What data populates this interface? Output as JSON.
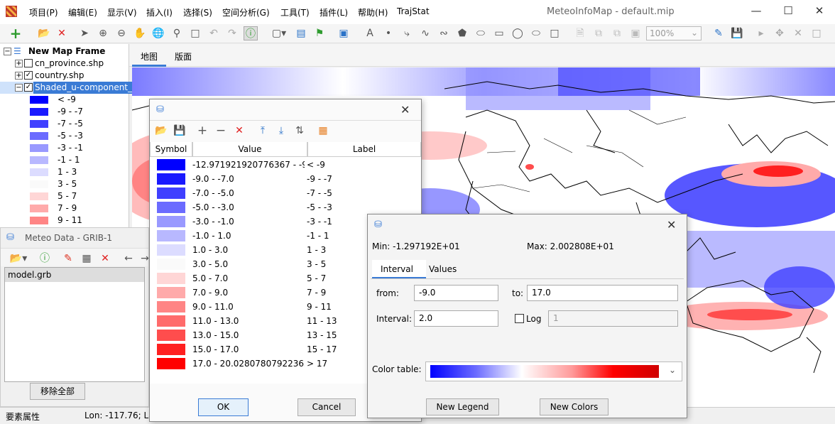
{
  "app": {
    "title": "MeteoInfoMap - default.mip",
    "menu": [
      "项目(P)",
      "编辑(E)",
      "显示(V)",
      "插入(I)",
      "选择(S)",
      "空间分析(G)",
      "工具(T)",
      "插件(L)",
      "帮助(H)",
      "TrajStat"
    ]
  },
  "toolbar": {
    "zoom": "100%"
  },
  "tree": {
    "frame": "New Map Frame",
    "layers": [
      {
        "name": "cn_province.shp",
        "checked": false
      },
      {
        "name": "country.shp",
        "checked": true
      },
      {
        "name": "Shaded_u-component_",
        "checked": true
      }
    ],
    "legend": [
      {
        "label": "< -9",
        "color": "#0000ff"
      },
      {
        "label": "-9 - -7",
        "color": "#1a1aff"
      },
      {
        "label": "-7 - -5",
        "color": "#4040ff"
      },
      {
        "label": "-5 - -3",
        "color": "#6b6bff"
      },
      {
        "label": "-3 - -1",
        "color": "#9999ff"
      },
      {
        "label": "-1 - 1",
        "color": "#b8b8ff"
      },
      {
        "label": "1 - 3",
        "color": "#dcdcff"
      },
      {
        "label": "3 - 5",
        "color": "#fafafa"
      },
      {
        "label": "5 - 7",
        "color": "#ffd6d6"
      },
      {
        "label": "7 - 9",
        "color": "#ffaaaa"
      },
      {
        "label": "9 - 11",
        "color": "#ff8585"
      }
    ]
  },
  "map_tabs": [
    "地图",
    "版面"
  ],
  "meteo": {
    "title": "Meteo Data - GRIB-1",
    "file": "model.grb",
    "remove_all": "移除全部"
  },
  "status": {
    "left": "要素属性",
    "coords": "Lon: -117.76; La"
  },
  "legend_editor": {
    "columns": [
      "Symbol",
      "Value",
      "Label"
    ],
    "rows": [
      {
        "value": "-12.971921920776367 - -9.0",
        "label": "< -9",
        "color": "#0000ff"
      },
      {
        "value": "-9.0 - -7.0",
        "label": "-9 - -7",
        "color": "#1a1aff"
      },
      {
        "value": "-7.0 - -5.0",
        "label": "-7 - -5",
        "color": "#4040ff"
      },
      {
        "value": "-5.0 - -3.0",
        "label": "-5 - -3",
        "color": "#6b6bff"
      },
      {
        "value": "-3.0 - -1.0",
        "label": "-3 - -1",
        "color": "#9999ff"
      },
      {
        "value": "-1.0 - 1.0",
        "label": "-1 - 1",
        "color": "#b8b8ff"
      },
      {
        "value": "1.0 - 3.0",
        "label": "1 - 3",
        "color": "#dcdcff"
      },
      {
        "value": "3.0 - 5.0",
        "label": "3 - 5",
        "color": "#fafafa"
      },
      {
        "value": "5.0 - 7.0",
        "label": "5 - 7",
        "color": "#ffd6d6"
      },
      {
        "value": "7.0 - 9.0",
        "label": "7 - 9",
        "color": "#ffaaaa"
      },
      {
        "value": "9.0 - 11.0",
        "label": "9 - 11",
        "color": "#ff8585"
      },
      {
        "value": "11.0 - 13.0",
        "label": "11 - 13",
        "color": "#ff6b6b"
      },
      {
        "value": "13.0 - 15.0",
        "label": "13 - 15",
        "color": "#ff4d4d"
      },
      {
        "value": "15.0 - 17.0",
        "label": "15 - 17",
        "color": "#ff2020"
      },
      {
        "value": "17.0 - 20.028078079223633",
        "label": "> 17",
        "color": "#ff0000"
      }
    ],
    "ok": "OK",
    "cancel": "Cancel"
  },
  "color_scheme": {
    "min": "Min: -1.297192E+01",
    "max": "Max: 2.002808E+01",
    "tabs": [
      "Interval",
      "Values"
    ],
    "from_label": "from:",
    "from_value": "-9.0",
    "to_label": "to:",
    "to_value": "17.0",
    "interval_label": "Interval:",
    "interval_value": "2.0",
    "log_label": "Log",
    "log_value": "1",
    "log_checked": false,
    "color_table_label": "Color table:",
    "new_legend": "New Legend",
    "new_colors": "New Colors"
  }
}
